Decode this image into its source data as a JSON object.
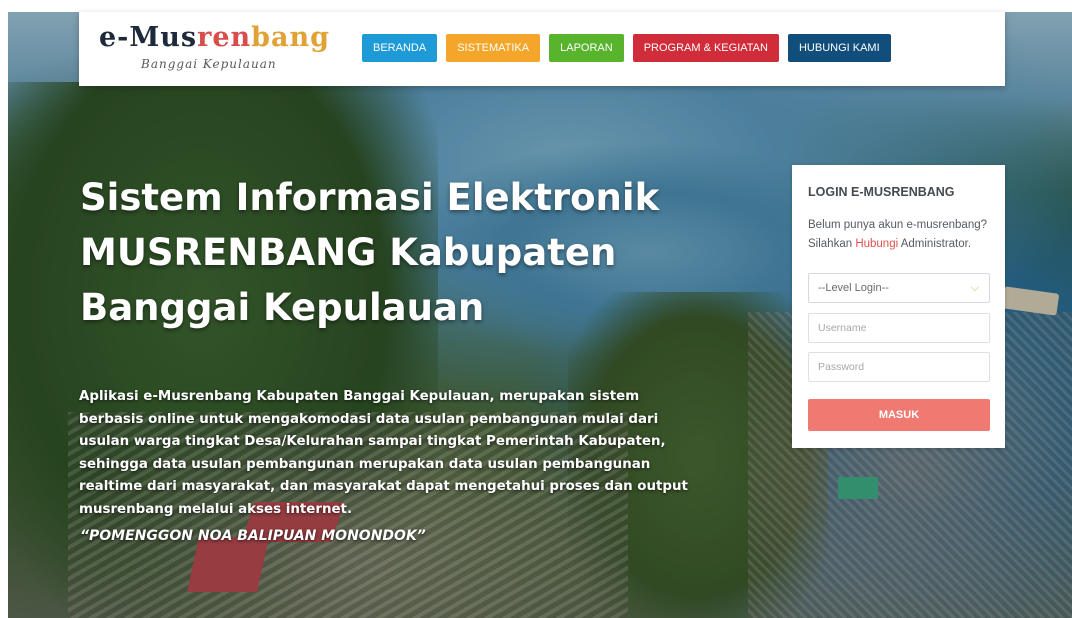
{
  "brand": {
    "logo_parts": [
      "e-Mus",
      "r",
      "en",
      "ba",
      "ng"
    ],
    "logo_sub": "Banggai Kepulauan"
  },
  "nav": {
    "items": [
      {
        "label": "BERANDA",
        "color": "#1e9bd7"
      },
      {
        "label": "SISTEMATIKA",
        "color": "#f4a62a"
      },
      {
        "label": "LAPORAN",
        "color": "#58b32d"
      },
      {
        "label": "PROGRAM & KEGIATAN",
        "color": "#d02c3a"
      },
      {
        "label": "HUBUNGI KAMI",
        "color": "#124e7c"
      }
    ]
  },
  "hero": {
    "headline": "Sistem Informasi Elektronik MUSRENBANG Kabupaten Banggai Kepulauan",
    "description": "Aplikasi e-Musrenbang Kabupaten Banggai Kepulauan, merupakan sistem berbasis online untuk mengakomodasi data usulan pembangunan mulai dari usulan warga tingkat Desa/Kelurahan sampai tingkat Pemerintah Kabupaten, sehingga data usulan pembangunan merupakan data usulan pembangunan realtime dari masyarakat, dan masyarakat dapat mengetahui proses dan output musrenbang melalui akses internet.",
    "motto": "“POMENGGON NOA BALIPUAN MONONDOK”"
  },
  "login": {
    "title": "LOGIN E-MUSRENBANG",
    "info_prefix": "Belum punya akun e-musrenbang? Silahkan ",
    "info_link": "Hubungi",
    "info_suffix": " Administrator.",
    "level_select": "--Level Login--",
    "username_placeholder": "Username",
    "password_placeholder": "Password",
    "submit_label": "MASUK"
  }
}
